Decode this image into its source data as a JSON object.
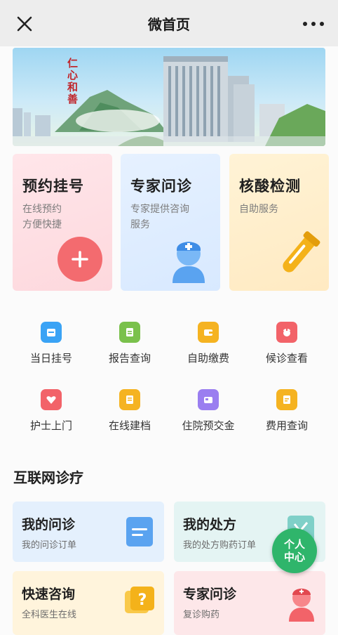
{
  "header": {
    "title": "微首页"
  },
  "banner": {
    "logo_text": "仁心和善"
  },
  "feature_cards": [
    {
      "title": "预约挂号",
      "subtitle": "在线预约\n方便快捷",
      "color": "#f36b6f"
    },
    {
      "title": "专家问诊",
      "subtitle": "专家提供咨询\n服务",
      "color": "#5aa3f0"
    },
    {
      "title": "核酸检测",
      "subtitle": "自助服务",
      "color": "#f4b21a"
    }
  ],
  "services": [
    {
      "label": "当日挂号",
      "icon": "calendar-icon",
      "color": "#3aa3f5"
    },
    {
      "label": "报告查询",
      "icon": "report-icon",
      "color": "#7ac14c"
    },
    {
      "label": "自助缴费",
      "icon": "wallet-icon",
      "color": "#f5b321"
    },
    {
      "label": "候诊查看",
      "icon": "nurse-icon",
      "color": "#f26369"
    },
    {
      "label": "护士上门",
      "icon": "heart-icon",
      "color": "#f26369"
    },
    {
      "label": "在线建档",
      "icon": "document-icon",
      "color": "#f5b321"
    },
    {
      "label": "住院预交金",
      "icon": "bed-icon",
      "color": "#9a7ef0"
    },
    {
      "label": "费用查询",
      "icon": "bill-icon",
      "color": "#f5b321"
    }
  ],
  "section": {
    "title": "互联网诊疗"
  },
  "online_cards": [
    {
      "title": "我的问诊",
      "subtitle": "我的问诊订单"
    },
    {
      "title": "我的处方",
      "subtitle": "我的处方购药订单"
    },
    {
      "title": "快速咨询",
      "subtitle": "全科医生在线"
    },
    {
      "title": "专家问诊",
      "subtitle": "复诊购药"
    }
  ],
  "fab": {
    "line1": "个人",
    "line2": "中心"
  }
}
